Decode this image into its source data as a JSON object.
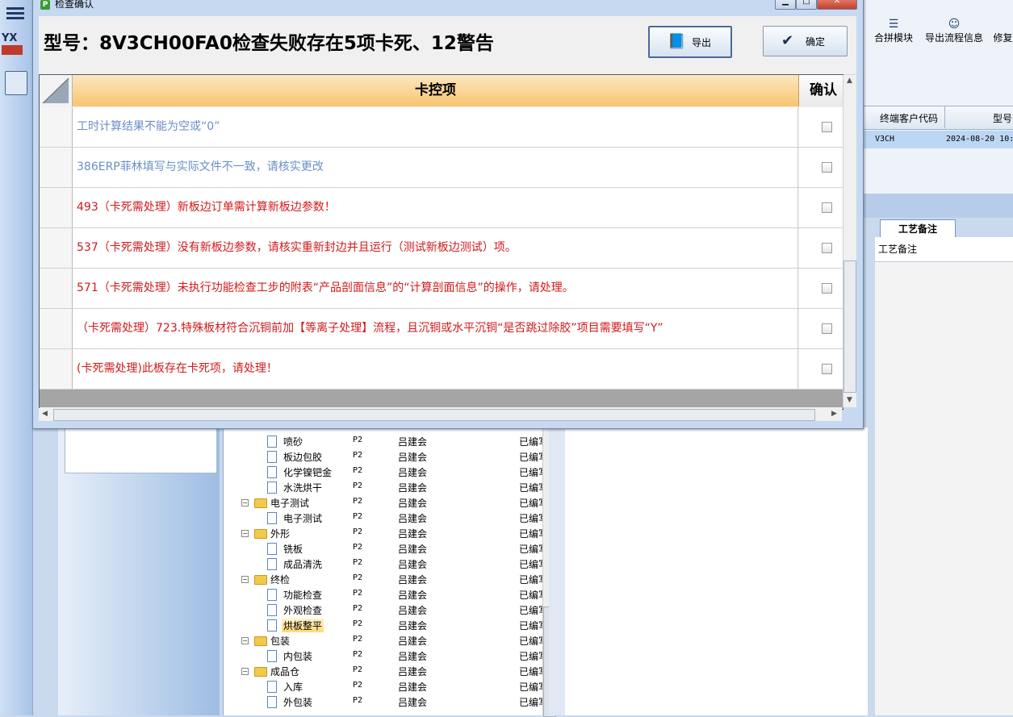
{
  "dialog": {
    "title": "检查确认",
    "headline": "型号：8V3CH00FA0检查失败存在5项卡死、12警告",
    "export_label": "导出",
    "ok_label": "确定",
    "col_main": "卡控项",
    "col_confirm": "确认",
    "rows": [
      {
        "text": "工时计算结果不能为空或“0”",
        "color": "#6a8fc5"
      },
      {
        "text": "386ERP菲林填写与实际文件不一致，请核实更改",
        "color": "#6a8fc5"
      },
      {
        "text": "493（卡死需处理）新板边订单需计算新板边参数！",
        "color": "#d11a1a"
      },
      {
        "text": "537（卡死需处理）没有新板边参数，请核实重新封边并且运行（测试新板边测试）项。",
        "color": "#d11a1a"
      },
      {
        "text": "571（卡死需处理）未执行功能检查工步的附表“产品剖面信息”的“计算剖面信息”的操作，请处理。",
        "color": "#d11a1a"
      },
      {
        "text": "（卡死需处理）723.特殊板材符合沉铜前加【等离子处理】流程，且沉铜或水平沉铜“是否跳过除胶”项目需要填写“Y”",
        "color": "#d11a1a"
      },
      {
        "text": "(卡死需处理)此板存在卡死项，请处理！",
        "color": "#d11a1a"
      }
    ]
  },
  "background": {
    "left_rail_logo": "YX",
    "toolbar": [
      {
        "icon": "list-icon",
        "label": "合拼模块"
      },
      {
        "icon": "smile-icon",
        "label": "导出流程信息"
      },
      {
        "icon": "edit-icon",
        "label": "修复"
      }
    ],
    "grid_headers": [
      "终端客户代码",
      "型号"
    ],
    "grid_row": {
      "col1": "V3CH",
      "col2": "2024-08-20 10:"
    },
    "tab_label": "工艺备注",
    "note_header": "工艺备注",
    "tree": [
      {
        "name": "喷砂",
        "type": "doc",
        "level": 2,
        "c1": "P2",
        "c2": "吕建会",
        "c3": "已编写"
      },
      {
        "name": "板边包胶",
        "type": "doc",
        "level": 2,
        "c1": "P2",
        "c2": "吕建会",
        "c3": "已编写"
      },
      {
        "name": "化学镍钯金",
        "type": "doc",
        "level": 2,
        "c1": "P2",
        "c2": "吕建会",
        "c3": "已编写"
      },
      {
        "name": "水洗烘干",
        "type": "doc",
        "level": 2,
        "c1": "P2",
        "c2": "吕建会",
        "c3": "已编写"
      },
      {
        "name": "电子测试",
        "type": "folder",
        "level": 1,
        "c1": "P2",
        "c2": "吕建会",
        "c3": "已编写"
      },
      {
        "name": "电子测试",
        "type": "doc",
        "level": 2,
        "c1": "P2",
        "c2": "吕建会",
        "c3": "已编写"
      },
      {
        "name": "外形",
        "type": "folder",
        "level": 1,
        "c1": "P2",
        "c2": "吕建会",
        "c3": "已编写"
      },
      {
        "name": "铣板",
        "type": "doc",
        "level": 2,
        "c1": "P2",
        "c2": "吕建会",
        "c3": "已编写"
      },
      {
        "name": "成品清洗",
        "type": "doc",
        "level": 2,
        "c1": "P2",
        "c2": "吕建会",
        "c3": "已编写"
      },
      {
        "name": "终检",
        "type": "folder",
        "level": 1,
        "c1": "P2",
        "c2": "吕建会",
        "c3": "已编写"
      },
      {
        "name": "功能检查",
        "type": "doc",
        "level": 2,
        "c1": "P2",
        "c2": "吕建会",
        "c3": "已编写"
      },
      {
        "name": "外观检查",
        "type": "doc",
        "level": 2,
        "c1": "P2",
        "c2": "吕建会",
        "c3": "已编写"
      },
      {
        "name": "烘板整平",
        "type": "doc",
        "level": 2,
        "c1": "P2",
        "c2": "吕建会",
        "c3": "已编写",
        "selected": true
      },
      {
        "name": "包装",
        "type": "folder",
        "level": 1,
        "c1": "P2",
        "c2": "吕建会",
        "c3": "已编写"
      },
      {
        "name": "内包装",
        "type": "doc",
        "level": 2,
        "c1": "P2",
        "c2": "吕建会",
        "c3": "已编写"
      },
      {
        "name": "成品仓",
        "type": "folder",
        "level": 1,
        "c1": "P2",
        "c2": "吕建会",
        "c3": "已编写"
      },
      {
        "name": "入库",
        "type": "doc",
        "level": 2,
        "c1": "P2",
        "c2": "吕建会",
        "c3": "已编写"
      },
      {
        "name": "外包装",
        "type": "doc",
        "level": 2,
        "c1": "P2",
        "c2": "吕建会",
        "c3": "已编写"
      }
    ]
  }
}
